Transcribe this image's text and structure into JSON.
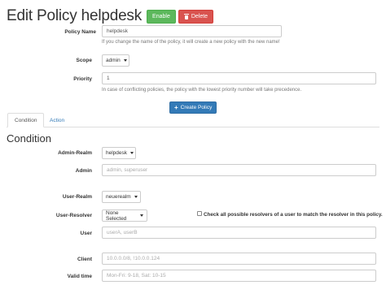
{
  "header": {
    "title": "Edit Policy helpdesk",
    "enable_label": "Enable",
    "delete_label": "Delete"
  },
  "policy": {
    "name_label": "Policy Name",
    "name_value": "helpdesk",
    "name_help": "If you change the name of the policy, it will create a new policy with the new name!",
    "scope_label": "Scope",
    "scope_value": "admin",
    "priority_label": "Priority",
    "priority_value": "1",
    "priority_help": "In case of conflicting policies, the policy with the lowest priority number will take precedence.",
    "create_label": "Create Policy"
  },
  "tabs": [
    {
      "label": "Condition",
      "active": true
    },
    {
      "label": "Action",
      "active": false
    }
  ],
  "condition": {
    "title": "Condition",
    "admin_realm_label": "Admin-Realm",
    "admin_realm_value": "helpdesk",
    "admin_label": "Admin",
    "admin_placeholder": "admin, superuser",
    "user_realm_label": "User-Realm",
    "user_realm_value": "neuerealm",
    "user_resolver_label": "User-Resolver",
    "user_resolver_value": "None Selected",
    "check_all_label": "Check all possible resolvers of a user to match the resolver in this policy.",
    "user_label": "User",
    "user_placeholder": "userA, userB",
    "client_label": "Client",
    "client_placeholder": "10.0.0.0/8, !10.0.0.124",
    "valid_time_label": "Valid time",
    "valid_time_placeholder": "Mon-Fri: 9-18, Sat: 10-15"
  },
  "colors": {
    "enable": "#5cb85c",
    "delete": "#d9534f",
    "primary": "#337ab7"
  },
  "icons": {
    "delete": "trash-icon",
    "create": "plus-icon",
    "select": "caret-down-icon"
  }
}
